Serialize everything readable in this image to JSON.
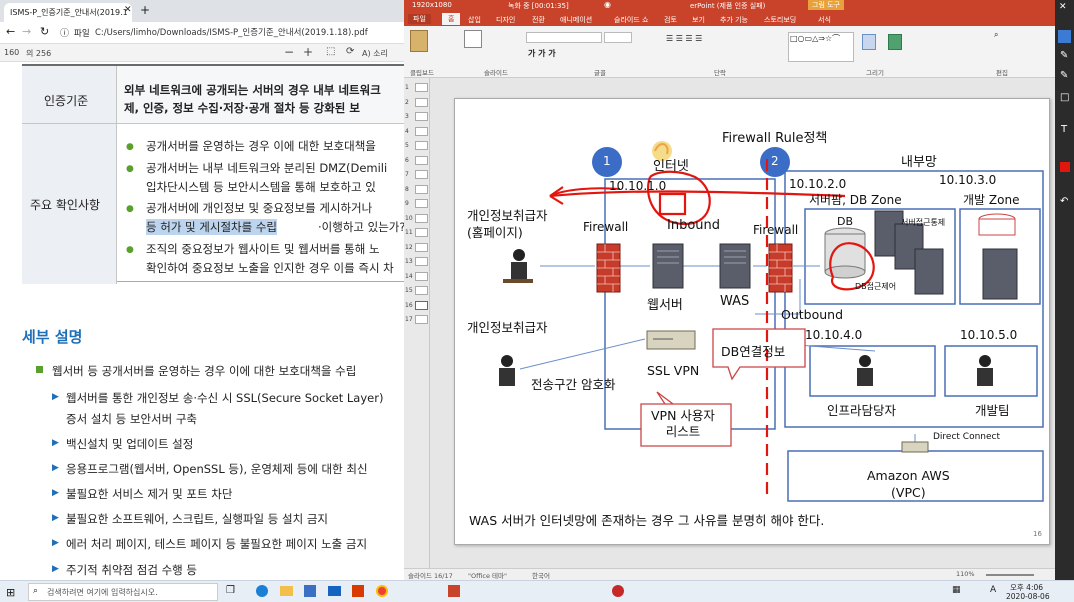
{
  "browser": {
    "tab_title": "ISMS-P_인증기준_안내서(2019.1",
    "url_prefix": "파일",
    "url": "C:/Users/limho/Downloads/ISMS-P_인증기준_안내서(2019.1.18).pdf",
    "page_current": "160",
    "page_total": "의 256",
    "zoom_out": "−",
    "zoom_in": "+",
    "read_aloud": "A) 소리"
  },
  "pdf": {
    "criteria_label": "인증기준",
    "criteria_text_1": "외부 네트워크에 공개되는 서버의 경우 내부 네트워크",
    "criteria_text_2": "제, 인증, 정보 수집·저장·공개 절차 등 강화된 보",
    "check_label": "주요 확인사항",
    "checks": [
      "공개서버를 운영하는 경우 이에 대한 보호대책을",
      "공개서버는 내부 네트워크와 분리된 DMZ(Demili",
      "입차단시스템 등 보안시스템을 통해 보호하고 있",
      "공개서버에 개인정보 및 중요정보를 게시하거나",
      "등 허가 및 게시절차를 수립",
      "·이행하고 있는가?",
      "조직의 중요정보가 웹사이트 및 웹서버를 통해 노",
      "확인하여 중요정보 노출을 인지한 경우 이를 즉시 차"
    ],
    "section_title": "세부 설명",
    "detail_main": "웹서버 등 공개서버를 운영하는 경우 이에 대한 보호대책을 수립",
    "detail_items": [
      "웹서버를 통한 개인정보 송·수신 시 SSL(Secure Socket Layer)",
      "증서 설치 등 보안서버 구축",
      "백신설치 및 업데이트 설정",
      "응용프로그램(웹서버, OpenSSL 등), 운영체제 등에 대한 최신",
      "불필요한 서비스 제거 및 포트 차단",
      "불필요한 소프트웨어, 스크립트, 실행파일 등 설치 금지",
      "에러 처리 페이지, 테스트 페이지 등 불필요한 페이지 노출 금지",
      "주기적 취약점 점검 수행 등"
    ]
  },
  "ppt": {
    "recording": "녹화 중 [00:01:35]",
    "resolution": "1920x1080",
    "window_title": "erPoint (제품 인증 실패)",
    "drawing_tools": "그림 도구",
    "tabs": [
      "파일",
      "홈",
      "삽입",
      "디자인",
      "전환",
      "애니메이션",
      "슬라이드 쇼",
      "검토",
      "보기",
      "추가 기능",
      "스토리보딩",
      "서식"
    ],
    "groups": [
      "클립보드",
      "슬라이드",
      "글꼴",
      "단락",
      "그리기",
      "편집"
    ],
    "status_left": "슬라이드 16/17",
    "status_theme": "\"Office 테마\"",
    "status_lang": "한국어",
    "zoom": "110%",
    "slide_numbers": [
      "1",
      "2",
      "3",
      "4",
      "5",
      "6",
      "7",
      "8",
      "9",
      "10",
      "11",
      "12",
      "13",
      "14",
      "15",
      "16",
      "17"
    ]
  },
  "slide": {
    "firewall_rule": "Firewall Rule정책",
    "circle_1": "1",
    "circle_2": "2",
    "internet": "인터넷",
    "internal": "내부망",
    "ip_10_1": "10.10.1.0",
    "ip_10_2": "10.10.2.0",
    "ip_10_3": "10.10.3.0",
    "ip_10_4": "10.10.4.0",
    "ip_10_5": "10.10.5.0",
    "server_farm": "서버팜, DB Zone",
    "dev_zone": "개발 Zone",
    "db": "DB",
    "server_access": "서버접근통제",
    "db_access": "DB접근제어",
    "personal_handler_home": "개인정보취급자\n(홈페이지)",
    "firewall_left": "Firewall",
    "firewall_right": "Firewall",
    "inbound": "Inbound",
    "outbound": "Outbound",
    "web_server": "웹서버",
    "was": "WAS",
    "personal_handler": "개인정보취급자",
    "db_conn": "DB연결정보",
    "transport_enc": "전송구간 암호화",
    "ssl_vpn": "SSL VPN",
    "vpn_user": "VPN 사용자\n리스트",
    "infra_admin": "인프라담당자",
    "dev_team": "개발팀",
    "direct_connect": "Direct Connect",
    "aws": "Amazon AWS\n(VPC)",
    "footer": "WAS 서버가 인터넷망에 존재하는 경우 그 사유를 분명히 해야 한다.",
    "page_no": "16"
  },
  "taskbar": {
    "search_placeholder": "검색하려면 여기에 입력하십시오.",
    "time": "오후 4:06",
    "date": "2020-08-06",
    "ime": "A"
  },
  "colors": {
    "ppt_accent": "#c8432a",
    "slide_blue": "#4a6fb5",
    "annotation_red": "#e3150f",
    "circle_blue": "#3c6dc6",
    "pdf_green": "#5aa02c",
    "section_blue": "#1f6fb8"
  }
}
